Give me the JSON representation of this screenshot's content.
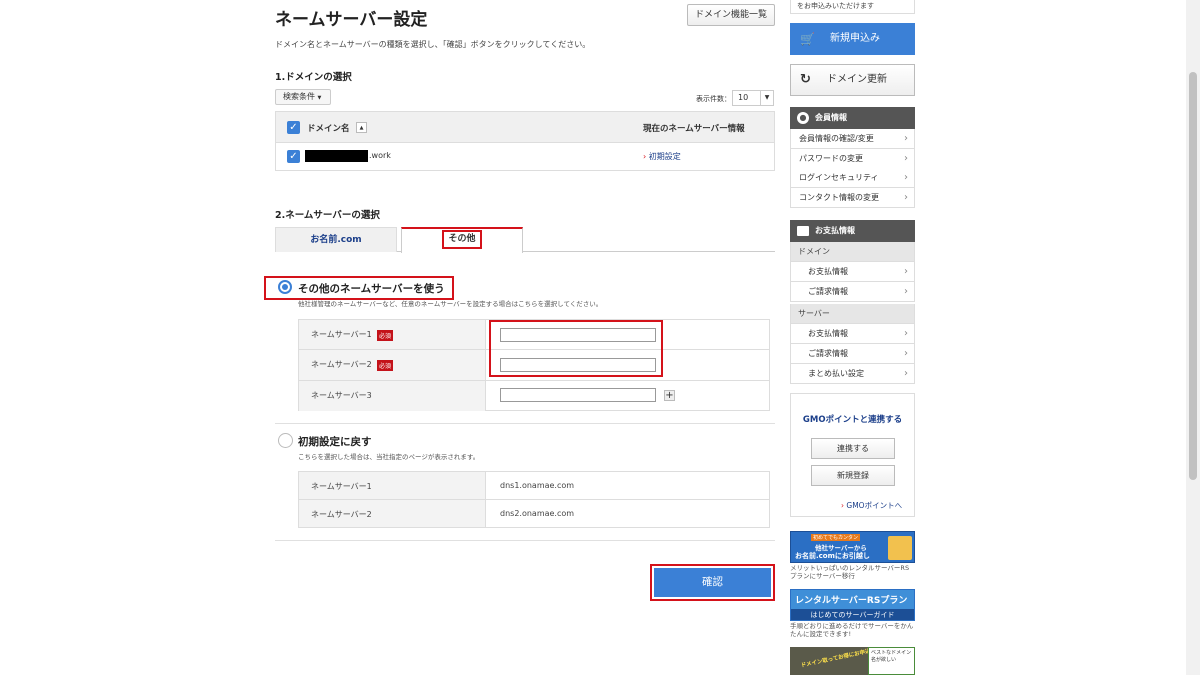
{
  "page": {
    "title": "ネームサーバー設定",
    "domain_list_button": "ドメイン機能一覧",
    "description": "ドメイン名とネームサーバーの種類を選択し、「確認」ボタンをクリックしてください。"
  },
  "domain_section": {
    "heading": "1.ドメインの選択",
    "filter_label": "検索条件",
    "display_count_label": "表示件数：",
    "display_count_value": "10",
    "table": {
      "col_domain": "ドメイン名",
      "col_current_ns": "現在のネームサーバー情報",
      "rows": [
        {
          "domain_suffix": ".work",
          "current_ns": "初期設定",
          "checked": true
        }
      ]
    }
  },
  "ns_section": {
    "heading": "2.ネームサーバーの選択",
    "tabs": [
      {
        "label": "お名前.com",
        "active": false
      },
      {
        "label": "その他",
        "active": true
      }
    ],
    "option_other": {
      "title": "その他のネームサーバーを使う",
      "subtitle": "他社様管理のネームサーバーなど、任意のネームサーバーを設定する場合はこちらを選択してください。",
      "selected": true,
      "rows": [
        {
          "label": "ネームサーバー1",
          "required": "必須",
          "value": ""
        },
        {
          "label": "ネームサーバー2",
          "required": "必須",
          "value": ""
        },
        {
          "label": "ネームサーバー3",
          "value": ""
        }
      ]
    },
    "option_default": {
      "title": "初期設定に戻す",
      "subtitle": "こちらを選択した場合は、当社指定のページが表示されます。",
      "selected": false,
      "rows": [
        {
          "label": "ネームサーバー1",
          "value": "dns1.onamae.com"
        },
        {
          "label": "ネームサーバー2",
          "value": "dns2.onamae.com"
        }
      ]
    }
  },
  "confirm_button": "確認",
  "sidebar": {
    "top_text": "をお申込みいただけます",
    "new_order": "新規申込み",
    "domain_renew": "ドメイン更新",
    "member": {
      "heading": "会員情報",
      "items": [
        "会員情報の確認/変更",
        "パスワードの変更",
        "ログインセキュリティ",
        "コンタクト情報の変更"
      ]
    },
    "payment": {
      "heading": "お支払情報",
      "domain_label": "ドメイン",
      "domain_items": [
        "お支払情報",
        "ご請求情報"
      ],
      "server_label": "サーバー",
      "server_items": [
        "お支払情報",
        "ご請求情報",
        "まとめ払い設定"
      ]
    },
    "gmo": {
      "title": "GMOポイントと連携する",
      "link_button": "連携する",
      "register_button": "新規登録",
      "points_link": "GMOポイントへ"
    },
    "banners": [
      {
        "headline1": "初めてでもカンタン",
        "headline2": "他社サーバーから",
        "headline3": "お名前.comにお引越し",
        "caption": "メリットいっぱいのレンタルサーバーRSプランにサーバー移行"
      },
      {
        "headline1": "レンタルサーバーRSプラン",
        "headline2": "はじめてのサーバーガイド",
        "caption": "手順どおりに進めるだけでサーバーをかんたんに設定できます!"
      },
      {
        "headline1": "ドメイン取ってお得にお申込み!",
        "headline2": "ベストなドメイン名が欲しい"
      }
    ]
  },
  "colors": {
    "accent": "#3b80d6",
    "highlight_red": "#d4121a",
    "required_badge": "#c4121a",
    "link": "#1c3f8a"
  }
}
